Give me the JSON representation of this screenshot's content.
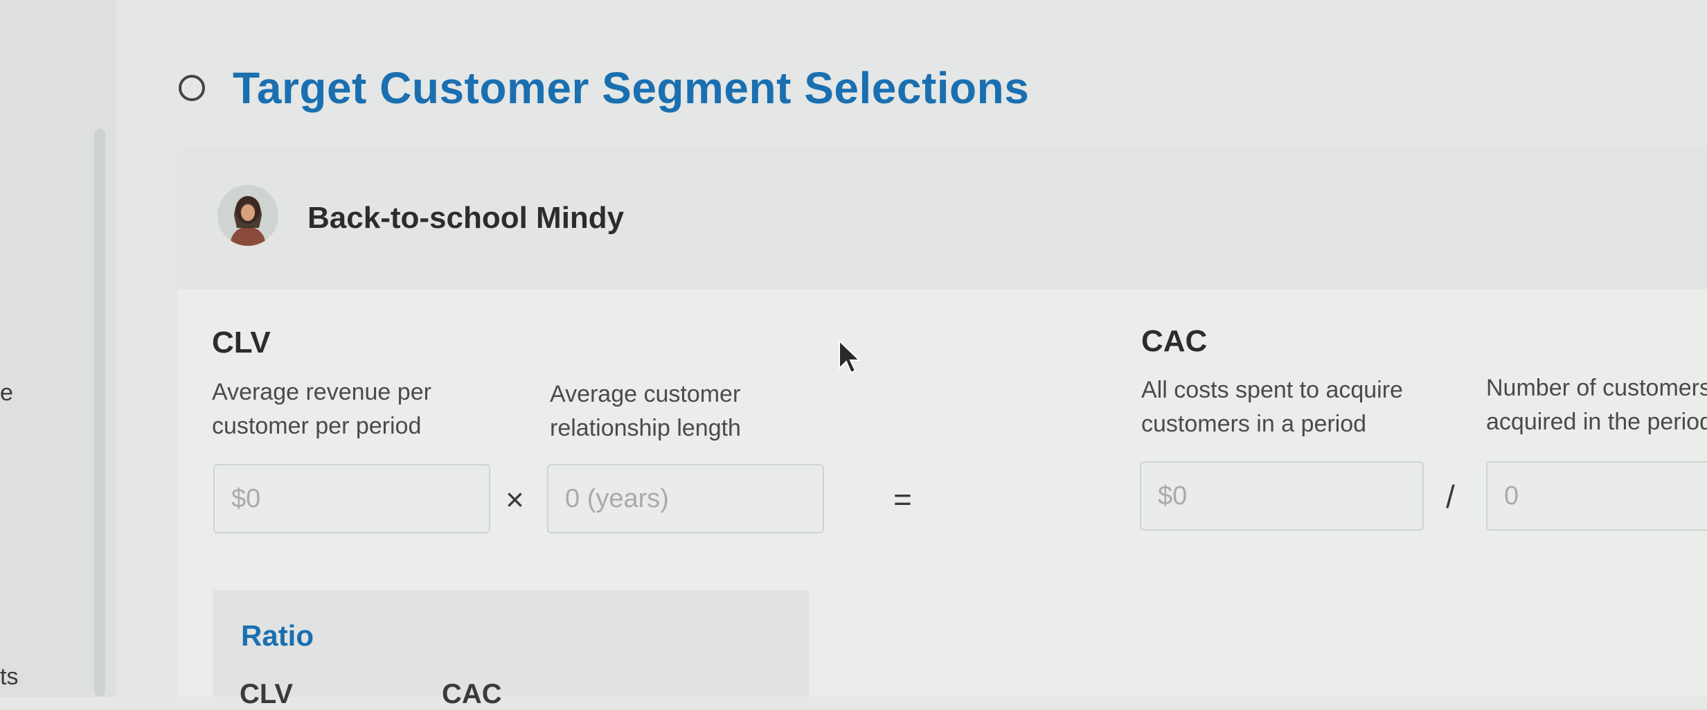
{
  "sidebar": {
    "fragment_top": "e",
    "fragment_bottom": "ts"
  },
  "section": {
    "title": "Target Customer Segment Selections"
  },
  "persona": {
    "name": "Back-to-school Mindy"
  },
  "clv": {
    "title": "CLV",
    "revenue_desc_line1": "Average revenue per",
    "revenue_desc_line2": "customer per period",
    "revenue_placeholder": "$0",
    "length_desc_line1": "Average customer",
    "length_desc_line2": "relationship length",
    "length_placeholder": "0 (years)",
    "multiply": "×",
    "equals": "="
  },
  "cac": {
    "title": "CAC",
    "costs_desc_line1": "All costs spent to acquire",
    "costs_desc_line2": "customers in a period",
    "costs_placeholder": "$0",
    "divide": "/",
    "customers_desc_line1": "Number of customers",
    "customers_desc_line2": "acquired in the period",
    "customers_placeholder": "0"
  },
  "ratio": {
    "title": "Ratio",
    "col_clv": "CLV",
    "col_cac": "CAC"
  },
  "colors": {
    "accent": "#1a6fb0",
    "background": "#e4e7e5"
  },
  "icons": {
    "header": "radio-circle-icon",
    "persona": "avatar-icon",
    "pointer": "mouse-cursor-icon"
  }
}
